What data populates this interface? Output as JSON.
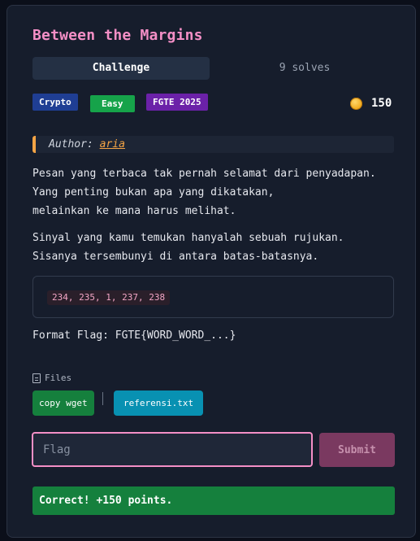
{
  "challenge": {
    "title": "Between the Margins",
    "tabs": {
      "challenge": "Challenge",
      "solves": "9 solves"
    },
    "tags": {
      "category": "Crypto",
      "difficulty": "Easy",
      "event": "FGTE 2025"
    },
    "points": "150",
    "author": {
      "label": "Author:",
      "name": "aria"
    },
    "description": [
      "Pesan yang terbaca tak pernah selamat dari penyadapan.",
      "Yang penting bukan apa yang dikatakan,",
      "melainkan ke mana harus melihat."
    ],
    "description2": [
      "Sinyal yang kamu temukan hanyalah sebuah rujukan.",
      "Sisanya tersembunyi di antara batas-batasnya."
    ],
    "code": "234, 235, 1, 237, 238",
    "flag_format": "Format Flag: FGTE{WORD_WORD_...}"
  },
  "files": {
    "label": "Files",
    "buttons": {
      "wget": "copy wget",
      "ref": "referensi.txt"
    },
    "separator": "|"
  },
  "submission": {
    "placeholder": "Flag",
    "submit_label": "Submit",
    "result": "Correct! +150 points."
  },
  "colors": {
    "title": "#f48fc6",
    "accent_orange": "#f4a445",
    "success": "#15803d",
    "info": "#0891b2",
    "category": "#1f3e94",
    "event": "#6b21a8"
  }
}
